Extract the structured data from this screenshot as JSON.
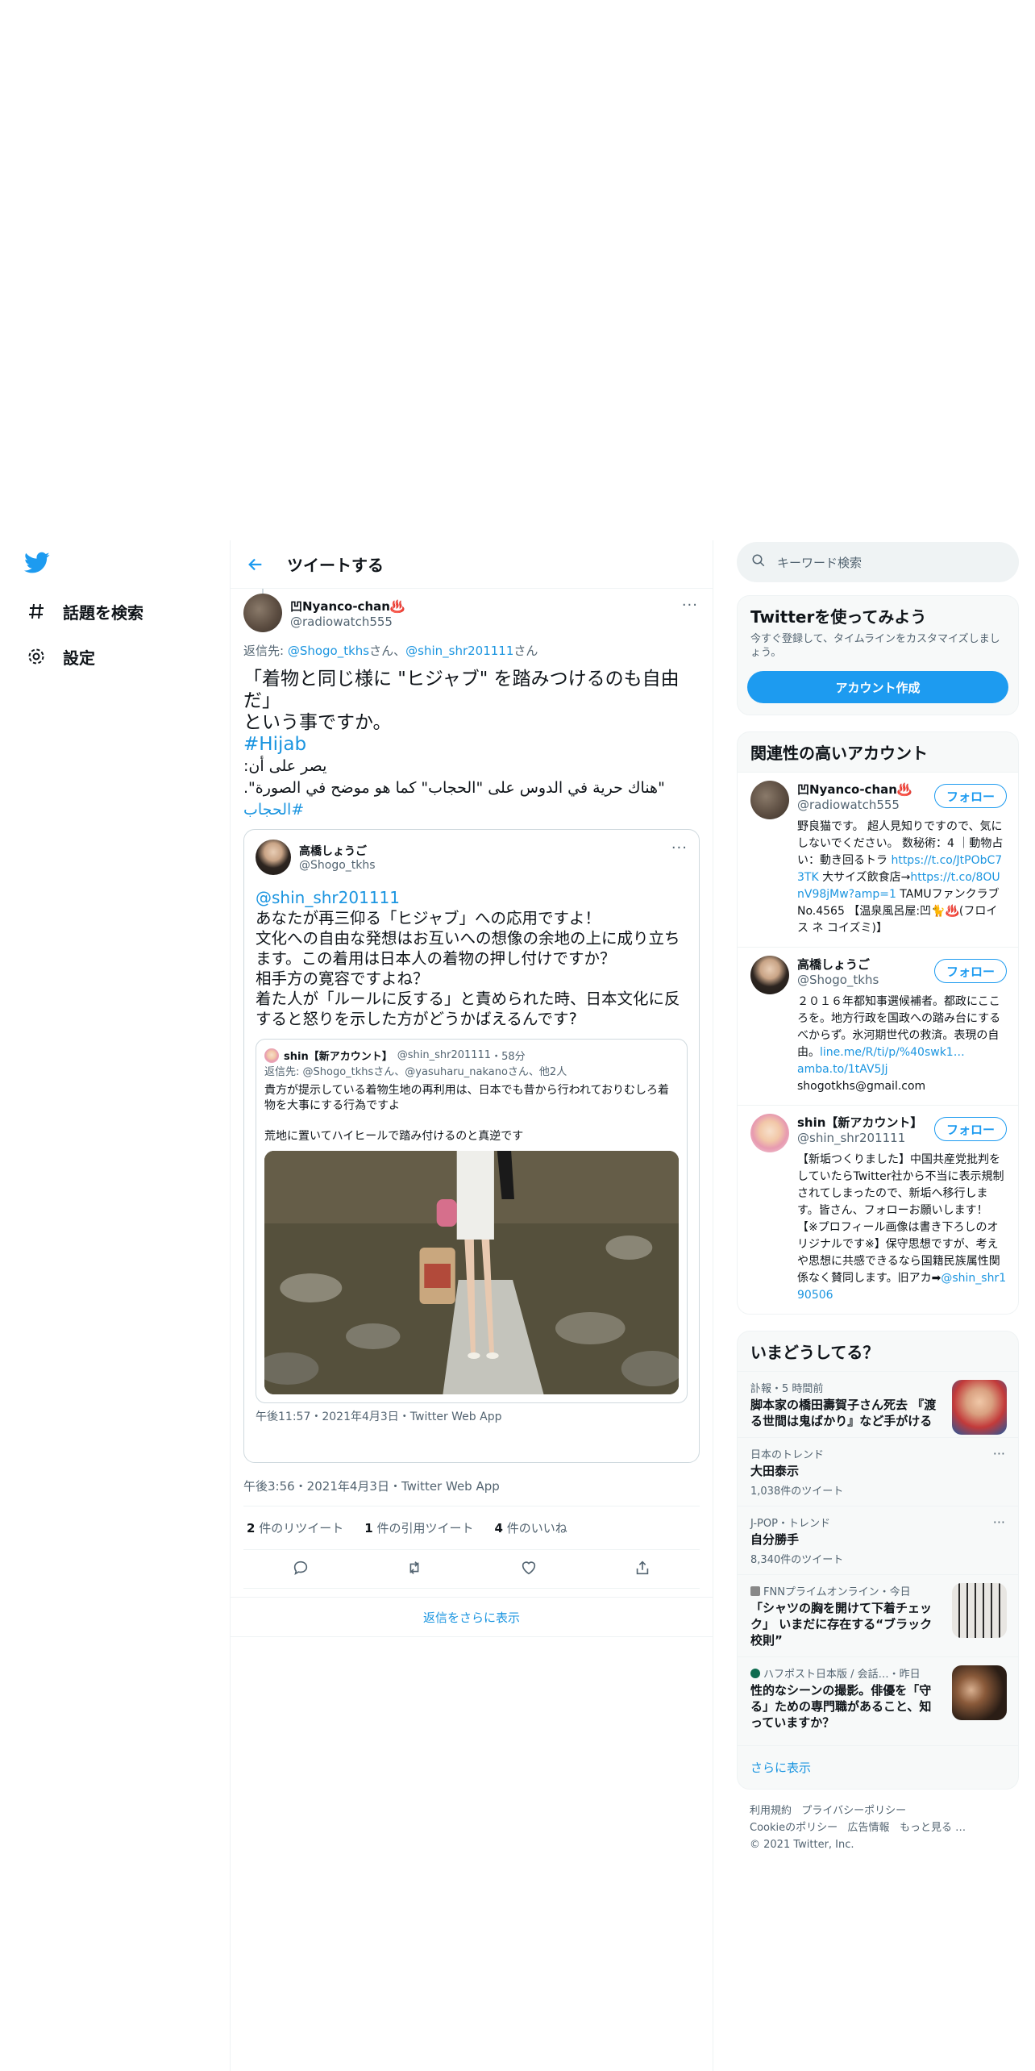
{
  "nav": {
    "explore": "話題を検索",
    "settings": "設定"
  },
  "header": {
    "title": "ツイートする"
  },
  "tweet": {
    "display_name": "凹Nyanco-chan♨️",
    "username": "@radiowatch555",
    "reply_prefix": "返信先: ",
    "reply_user1": "@Shogo_tkhs",
    "reply_mid": "さん、",
    "reply_user2": "@shin_shr201111",
    "reply_suffix": "さん",
    "body_text": "「着物と同じ様に \"ヒジャブ\" を踏みつけるのも自由だ」\nという事ですか。",
    "hashtag1": "#Hijab",
    "arabic_text": "يصر على أن:\n\"هناك حرية في الدوس على \"الحجاب\" كما هو موضح في الصورة\".",
    "hashtag2": "#الحجاب",
    "timestamp": "午後3:56・2021年4月3日・Twitter Web App",
    "retweets_num": "2",
    "retweets_label": "件のリツイート",
    "quotes_num": "1",
    "quotes_label": "件の引用ツイート",
    "likes_num": "4",
    "likes_label": "件のいいね"
  },
  "quoted": {
    "display_name": "高橋しょうご",
    "username": "@Shogo_tkhs",
    "mention": "@shin_shr201111",
    "body_text": "あなたが再三仰る「ヒジャブ」への応用ですよ！\n文化への自由な発想はお互いへの想像の余地の上に成り立ちます。この着用は日本人の着物の押し付けですか？\n相手方の寛容ですよね？\n着た人が「ルールに反する」と責められた時、日本文化に反すると怒りを示した方がどうかばえるんです?",
    "timestamp": "午後11:57・2021年4月3日・Twitter Web App"
  },
  "nested": {
    "display_name": "shin【新アカウント】",
    "username": "@shin_shr201111",
    "time": "・58分",
    "reply_text": "返信先: @Shogo_tkhsさん、@yasuharu_nakanoさん、他2人",
    "body_text": "貴方が提示している着物生地の再利用は、日本でも昔から行われておりむしろ着物を大事にする行為ですよ\n\n荒地に置いてハイヒールで踏み付けるのと真逆です"
  },
  "show_more_replies": "返信をさらに表示",
  "search": {
    "placeholder": "キーワード検索"
  },
  "signup": {
    "title": "Twitterを使ってみよう",
    "desc": "今すぐ登録して、タイムラインをカスタマイズしましょう。",
    "button": "アカウント作成"
  },
  "relevant": {
    "title": "関連性の高いアカウント",
    "follow_label": "フォロー",
    "accounts": [
      {
        "display_name": "凹Nyanco-chan♨️",
        "username": "@radiowatch555",
        "bio1": "野良猫です。 超人見知りですので、気にしないでください。 数秘術：4 ｜動物占い：動き回るトラ ",
        "bio_link1": "https://t.co/JtPObC73TK",
        "bio2": " 大サイズ飲食店→",
        "bio_link2": "https://t.co/8OUnV98jMw?amp=1",
        "bio3": " TAMUファンクラブNo.4565 【温泉風呂屋:凹🐈♨️(フロイス ネ コイズミ)】"
      },
      {
        "display_name": "高橋しょうご",
        "username": "@Shogo_tkhs",
        "bio1": "２０１６年都知事選候補者。都政にこころを。地方行政を国政への踏み台にするべからず。氷河期世代の救済。表現の自由。",
        "bio_link1": "line.me/R/ti/p/%40swk1…",
        "bio_link2": "amba.to/1tAV5Jj",
        "bio3": "shogotkhs@gmail.com"
      },
      {
        "display_name": "shin【新アカウント】",
        "username": "@shin_shr201111",
        "bio1": "【新垢つくりました】中国共産党批判をしていたらTwitter社から不当に表示規制されてしまったので、新垢へ移行します。皆さん、フォローお願いします！【※プロフィール画像は書き下ろしのオリジナルです※】保守思想ですが、考えや思想に共感できるなら国籍民族属性関係なく賛同します。旧アカ➡",
        "bio_link1": "@shin_shr190506"
      }
    ]
  },
  "trends": {
    "title": "いまどうしてる？",
    "items": [
      {
        "context": "訃報・5 時間前",
        "title": "脚本家の橋田壽賀子さん死去 『渡る世間は鬼ばかり』など手がける",
        "count": ""
      },
      {
        "context": "日本のトレンド",
        "title": "大田泰示",
        "count": "1,038件のツイート"
      },
      {
        "context": "J-POP・トレンド",
        "title": "自分勝手",
        "count": "8,340件のツイート"
      },
      {
        "context": "FNNプライムオンライン・今日",
        "title": "「シャツの胸を開けて下着チェック」 いまだに存在する“ブラック校則”",
        "count": ""
      },
      {
        "context": "ハフポスト日本版 / 会話…・昨日",
        "title": "性的なシーンの撮影。俳優を「守る」ための専門職があること、知っていますか？",
        "count": ""
      }
    ],
    "show_more": "さらに表示"
  },
  "footer": {
    "terms": "利用規約",
    "privacy": "プライバシーポリシー",
    "cookie": "Cookieのポリシー",
    "ads": "広告情報",
    "more": "もっと見る …",
    "copyright": "© 2021 Twitter, Inc."
  },
  "colors": {
    "accent": "#1d9bf0",
    "link": "#1b95e0",
    "text": "#0f1419",
    "secondary": "#536471"
  }
}
